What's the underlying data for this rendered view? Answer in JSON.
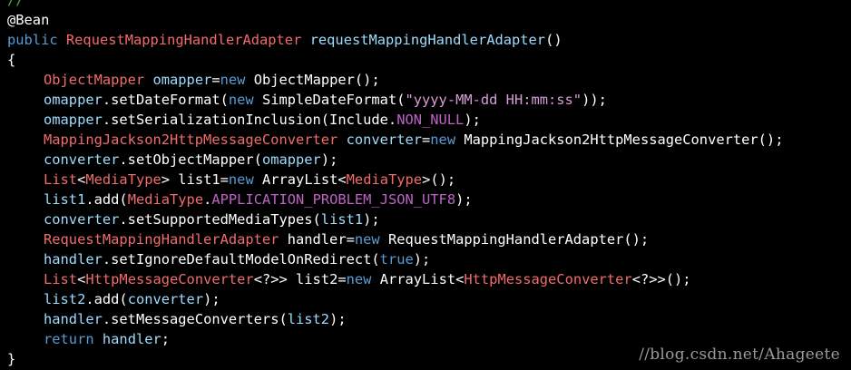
{
  "editor": {
    "lines": [
      {
        "tokens": [
          {
            "c": "cm",
            "t": "//"
          }
        ]
      },
      {
        "tokens": [
          {
            "c": "an",
            "t": "@Bean"
          }
        ]
      },
      {
        "tokens": [
          {
            "c": "kw",
            "t": "public"
          },
          {
            "c": "pl",
            "t": " "
          },
          {
            "c": "ty",
            "t": "RequestMappingHandlerAdapter"
          },
          {
            "c": "pl",
            "t": " "
          },
          {
            "c": "vr",
            "t": "requestMappingHandlerAdapter"
          },
          {
            "c": "pl",
            "t": "()"
          }
        ]
      },
      {
        "tokens": [
          {
            "c": "pl",
            "t": "{"
          }
        ]
      },
      {
        "indent": 1,
        "tokens": [
          {
            "c": "ty",
            "t": "ObjectMapper"
          },
          {
            "c": "pl",
            "t": " "
          },
          {
            "c": "vr",
            "t": "omapper"
          },
          {
            "c": "pl",
            "t": "="
          },
          {
            "c": "kw",
            "t": "new"
          },
          {
            "c": "pl",
            "t": " ObjectMapper();"
          }
        ]
      },
      {
        "indent": 1,
        "tokens": [
          {
            "c": "vr",
            "t": "omapper"
          },
          {
            "c": "pl",
            "t": ".setDateFormat("
          },
          {
            "c": "kw",
            "t": "new"
          },
          {
            "c": "pl",
            "t": " SimpleDateFormat("
          },
          {
            "c": "st",
            "t": "\"yyyy-MM-dd HH:mm:ss\""
          },
          {
            "c": "pl",
            "t": "));"
          }
        ]
      },
      {
        "indent": 1,
        "tokens": [
          {
            "c": "vr",
            "t": "omapper"
          },
          {
            "c": "pl",
            "t": ".setSerializationInclusion(Include."
          },
          {
            "c": "cn",
            "t": "NON_NULL"
          },
          {
            "c": "pl",
            "t": ");"
          }
        ]
      },
      {
        "indent": 1,
        "tokens": [
          {
            "c": "ty",
            "t": "MappingJackson2HttpMessageConverter"
          },
          {
            "c": "pl",
            "t": " "
          },
          {
            "c": "vr",
            "t": "converter"
          },
          {
            "c": "pl",
            "t": "="
          },
          {
            "c": "kw",
            "t": "new"
          },
          {
            "c": "pl",
            "t": " MappingJackson2HttpMessageConverter();"
          }
        ]
      },
      {
        "indent": 1,
        "tokens": [
          {
            "c": "vr",
            "t": "converter"
          },
          {
            "c": "pl",
            "t": ".setObjectMapper("
          },
          {
            "c": "vr",
            "t": "omapper"
          },
          {
            "c": "pl",
            "t": ");"
          }
        ]
      },
      {
        "indent": 1,
        "tokens": [
          {
            "c": "ty",
            "t": "List"
          },
          {
            "c": "pl",
            "t": "<"
          },
          {
            "c": "ty",
            "t": "MediaType"
          },
          {
            "c": "pl",
            "t": "> list1="
          },
          {
            "c": "kw",
            "t": "new"
          },
          {
            "c": "pl",
            "t": " ArrayList<"
          },
          {
            "c": "ty",
            "t": "MediaType"
          },
          {
            "c": "pl",
            "t": ">();"
          }
        ]
      },
      {
        "indent": 1,
        "tokens": [
          {
            "c": "vr",
            "t": "list1"
          },
          {
            "c": "pl",
            "t": ".add("
          },
          {
            "c": "ty",
            "t": "MediaType"
          },
          {
            "c": "pl",
            "t": "."
          },
          {
            "c": "cn",
            "t": "APPLICATION_PROBLEM_JSON_UTF8"
          },
          {
            "c": "pl",
            "t": ");"
          }
        ]
      },
      {
        "indent": 1,
        "tokens": [
          {
            "c": "vr",
            "t": "converter"
          },
          {
            "c": "pl",
            "t": ".setSupportedMediaTypes("
          },
          {
            "c": "vr",
            "t": "list1"
          },
          {
            "c": "pl",
            "t": ");"
          }
        ]
      },
      {
        "indent": 1,
        "tokens": [
          {
            "c": "ty",
            "t": "RequestMappingHandlerAdapter"
          },
          {
            "c": "pl",
            "t": " handler="
          },
          {
            "c": "kw",
            "t": "new"
          },
          {
            "c": "pl",
            "t": " RequestMappingHandlerAdapter();"
          }
        ]
      },
      {
        "indent": 1,
        "tokens": [
          {
            "c": "vr",
            "t": "handler"
          },
          {
            "c": "pl",
            "t": ".setIgnoreDefaultModelOnRedirect("
          },
          {
            "c": "kw",
            "t": "true"
          },
          {
            "c": "pl",
            "t": ");"
          }
        ]
      },
      {
        "indent": 1,
        "tokens": [
          {
            "c": "ty",
            "t": "List"
          },
          {
            "c": "pl",
            "t": "<"
          },
          {
            "c": "ty",
            "t": "HttpMessageConverter"
          },
          {
            "c": "pl",
            "t": "<?>> list2="
          },
          {
            "c": "kw",
            "t": "new"
          },
          {
            "c": "pl",
            "t": " ArrayList<"
          },
          {
            "c": "ty",
            "t": "HttpMessageConverter"
          },
          {
            "c": "pl",
            "t": "<?>>();"
          }
        ]
      },
      {
        "indent": 1,
        "tokens": [
          {
            "c": "vr",
            "t": "list2"
          },
          {
            "c": "pl",
            "t": ".add("
          },
          {
            "c": "vr",
            "t": "converter"
          },
          {
            "c": "pl",
            "t": ");"
          }
        ]
      },
      {
        "indent": 1,
        "tokens": [
          {
            "c": "vr",
            "t": "handler"
          },
          {
            "c": "pl",
            "t": ".setMessageConverters("
          },
          {
            "c": "vr",
            "t": "list2"
          },
          {
            "c": "pl",
            "t": ");"
          }
        ]
      },
      {
        "indent": 1,
        "tokens": [
          {
            "c": "kw",
            "t": "return"
          },
          {
            "c": "pl",
            "t": " "
          },
          {
            "c": "vr",
            "t": "handler"
          },
          {
            "c": "pl",
            "t": ";"
          }
        ]
      },
      {
        "tokens": [
          {
            "c": "pl",
            "t": "}"
          }
        ]
      }
    ]
  },
  "watermark": "//blog.csdn.net/Ahageete",
  "colors": {
    "background": "#000000",
    "keyword": "#569cd6",
    "type": "#f26b6b",
    "variable": "#9cdcfe",
    "string": "#d69dd6",
    "constant": "#bd63c5",
    "plain": "#ffffff",
    "comment": "#57a64a"
  }
}
